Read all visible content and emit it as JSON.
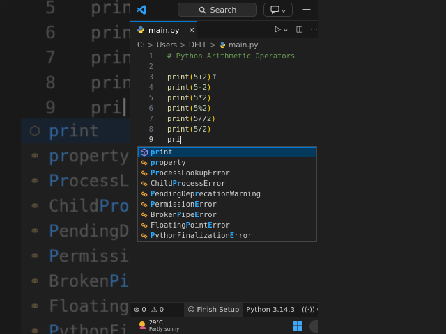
{
  "background_zoom": {
    "lines": [
      {
        "number": "5",
        "code": "prin"
      },
      {
        "number": "6",
        "code": "prin"
      },
      {
        "number": "7",
        "code": "prin"
      },
      {
        "number": "8",
        "code": "prin"
      },
      {
        "number": "9",
        "code": "pri"
      }
    ],
    "suggestions": [
      {
        "match": "pr",
        "rest": "int"
      },
      {
        "match": "pr",
        "rest": "operty"
      },
      {
        "match": "P",
        "mid": "r",
        "rest": "ocessL"
      },
      {
        "pre": "Child",
        "match": "Pro",
        "rest": ""
      },
      {
        "match": "P",
        "rest": "endingD"
      },
      {
        "match": "P",
        "rest": "ermissi"
      },
      {
        "pre": "Broken",
        "match": "Pi",
        "rest": ""
      },
      {
        "pre": "Floating",
        "match": "",
        "rest": ""
      },
      {
        "match": "P",
        "rest": "ythonFi"
      }
    ]
  },
  "titlebar": {
    "search_label": "Search",
    "minimize": "—"
  },
  "tab": {
    "label": "main.py",
    "close": "✕"
  },
  "breadcrumb": {
    "items": [
      "C:",
      "Users",
      "DELL",
      "main.py"
    ],
    "separator": ">"
  },
  "editor": {
    "lines": [
      {
        "number": "1",
        "tokens": [
          {
            "t": "# Python Arithmetic Operators",
            "c": "comment"
          }
        ]
      },
      {
        "number": "2",
        "tokens": []
      },
      {
        "number": "3",
        "tokens": [
          {
            "t": "print",
            "c": "fn"
          },
          {
            "t": "(",
            "c": "paren"
          },
          {
            "t": "5",
            "c": "num"
          },
          {
            "t": "+",
            "c": "op"
          },
          {
            "t": "2",
            "c": "num"
          },
          {
            "t": ")",
            "c": "paren"
          }
        ]
      },
      {
        "number": "4",
        "tokens": [
          {
            "t": "print",
            "c": "fn"
          },
          {
            "t": "(",
            "c": "paren"
          },
          {
            "t": "5",
            "c": "num"
          },
          {
            "t": "-",
            "c": "op"
          },
          {
            "t": "2",
            "c": "num"
          },
          {
            "t": ")",
            "c": "paren"
          }
        ]
      },
      {
        "number": "5",
        "tokens": [
          {
            "t": "print",
            "c": "fn"
          },
          {
            "t": "(",
            "c": "paren"
          },
          {
            "t": "5",
            "c": "num"
          },
          {
            "t": "*",
            "c": "op"
          },
          {
            "t": "2",
            "c": "num"
          },
          {
            "t": ")",
            "c": "paren"
          }
        ]
      },
      {
        "number": "6",
        "tokens": [
          {
            "t": "print",
            "c": "fn"
          },
          {
            "t": "(",
            "c": "paren"
          },
          {
            "t": "5",
            "c": "num"
          },
          {
            "t": "%",
            "c": "op"
          },
          {
            "t": "2",
            "c": "num"
          },
          {
            "t": ")",
            "c": "paren"
          }
        ]
      },
      {
        "number": "7",
        "tokens": [
          {
            "t": "print",
            "c": "fn"
          },
          {
            "t": "(",
            "c": "paren"
          },
          {
            "t": "5",
            "c": "num"
          },
          {
            "t": "//",
            "c": "op"
          },
          {
            "t": "2",
            "c": "num"
          },
          {
            "t": ")",
            "c": "paren"
          }
        ]
      },
      {
        "number": "8",
        "tokens": [
          {
            "t": "print",
            "c": "fn"
          },
          {
            "t": "(",
            "c": "paren"
          },
          {
            "t": "5",
            "c": "num"
          },
          {
            "t": "/",
            "c": "op"
          },
          {
            "t": "2",
            "c": "num"
          },
          {
            "t": ")",
            "c": "paren"
          }
        ]
      },
      {
        "number": "9",
        "tokens": [
          {
            "t": "pri",
            "c": "plain"
          }
        ]
      }
    ],
    "active_line": "9"
  },
  "suggestions": [
    {
      "kind": "function",
      "parts": [
        {
          "t": "pr",
          "m": true
        },
        {
          "t": "int",
          "m": false
        }
      ]
    },
    {
      "kind": "variable",
      "parts": [
        {
          "t": "pr",
          "m": true
        },
        {
          "t": "operty",
          "m": false
        }
      ]
    },
    {
      "kind": "variable",
      "parts": [
        {
          "t": "P",
          "m": true
        },
        {
          "t": "r",
          "m": true
        },
        {
          "t": "ocessLookupError",
          "m": false
        }
      ]
    },
    {
      "kind": "variable",
      "parts": [
        {
          "t": "Child",
          "m": false
        },
        {
          "t": "Pr",
          "m": true
        },
        {
          "t": "ocessError",
          "m": false
        }
      ]
    },
    {
      "kind": "variable",
      "parts": [
        {
          "t": "P",
          "m": true
        },
        {
          "t": "endingDep",
          "m": false
        },
        {
          "t": "r",
          "m": true
        },
        {
          "t": "ecationWarning",
          "m": false
        }
      ]
    },
    {
      "kind": "variable",
      "parts": [
        {
          "t": "P",
          "m": true
        },
        {
          "t": "ermission",
          "m": false
        },
        {
          "t": "E",
          "m": true
        },
        {
          "t": "rror",
          "m": false
        }
      ]
    },
    {
      "kind": "variable",
      "parts": [
        {
          "t": "Broken",
          "m": false
        },
        {
          "t": "P",
          "m": true
        },
        {
          "t": "ipe",
          "m": false
        },
        {
          "t": "E",
          "m": true
        },
        {
          "t": "rror",
          "m": false
        }
      ]
    },
    {
      "kind": "variable",
      "parts": [
        {
          "t": "Floating",
          "m": false
        },
        {
          "t": "P",
          "m": true
        },
        {
          "t": "oint",
          "m": false
        },
        {
          "t": "E",
          "m": true
        },
        {
          "t": "rror",
          "m": false
        }
      ]
    },
    {
      "kind": "variable",
      "parts": [
        {
          "t": "P",
          "m": true
        },
        {
          "t": "ythonFinalization",
          "m": false
        },
        {
          "t": "E",
          "m": true
        },
        {
          "t": "rror",
          "m": false
        }
      ]
    }
  ],
  "statusbar": {
    "errors": "0",
    "warnings": "0",
    "finish_setup": "Finish Setup",
    "python_version": "Python 3.14.3",
    "go_live": "Go"
  },
  "taskbar": {
    "temperature": "29°C",
    "weather": "Partly sunny"
  },
  "colors": {
    "accent": "#0078d4",
    "match": "#2aaaff",
    "selection": "#04395e"
  }
}
